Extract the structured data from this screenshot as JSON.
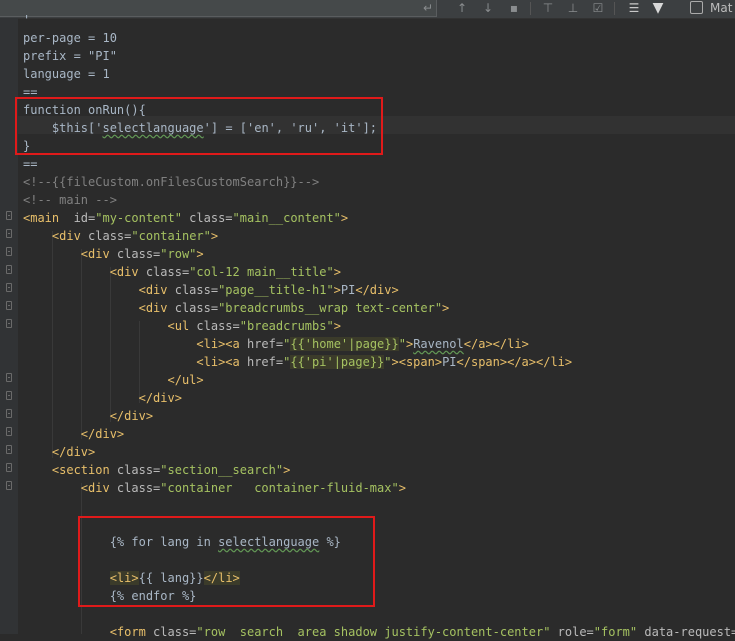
{
  "toolbar": {
    "icons": [
      "enter-icon",
      "arrow-up-icon",
      "arrow-down-icon",
      "select-all-icon",
      "add-occurrence-icon",
      "remove-occurrence-icon",
      "check-occurrence-icon",
      "multiline-icon",
      "filter-icon"
    ],
    "match_case_label": "Mat"
  },
  "code": {
    "lines": [
      {
        "segments": [
          {
            "t": "'",
            "c": "t-txt"
          }
        ]
      },
      {
        "segments": [
          {
            "t": "per-page = 10",
            "c": "t-txt"
          }
        ]
      },
      {
        "segments": [
          {
            "t": "prefix = \"PI\"",
            "c": "t-txt"
          }
        ]
      },
      {
        "segments": [
          {
            "t": "language = 1",
            "c": "t-txt"
          }
        ]
      },
      {
        "segments": [
          {
            "t": "==",
            "c": "t-txt"
          }
        ]
      },
      {
        "segments": [
          {
            "t": "function onRun(){",
            "c": "t-txt"
          }
        ]
      },
      {
        "segments": [
          {
            "t": "    $this['",
            "c": "t-txt"
          },
          {
            "t": "selectlanguage",
            "c": "t-txt t-und"
          },
          {
            "t": "'] = ['en', 'ru', 'it'];",
            "c": "t-txt"
          }
        ]
      },
      {
        "segments": [
          {
            "t": "}",
            "c": "t-txt"
          }
        ]
      },
      {
        "segments": [
          {
            "t": "==",
            "c": "t-txt"
          }
        ]
      },
      {
        "segments": [
          {
            "t": "<!--{{fileCustom.onFilesCustomSearch}}-->",
            "c": "t-cmt"
          }
        ]
      },
      {
        "segments": [
          {
            "t": "<!-- main -->",
            "c": "t-cmt"
          }
        ]
      },
      {
        "segments": [
          {
            "t": "<main",
            "c": "t-tag"
          },
          {
            "t": "  id=",
            "c": "t-attr"
          },
          {
            "t": "\"my-content\"",
            "c": "t-str"
          },
          {
            "t": " class=",
            "c": "t-attr"
          },
          {
            "t": "\"main__content\"",
            "c": "t-str"
          },
          {
            "t": ">",
            "c": "t-tag"
          }
        ]
      },
      {
        "segments": [
          {
            "t": "    ",
            "c": "t-txt"
          },
          {
            "t": "<div",
            "c": "t-tag"
          },
          {
            "t": " class=",
            "c": "t-attr"
          },
          {
            "t": "\"container\"",
            "c": "t-str"
          },
          {
            "t": ">",
            "c": "t-tag"
          }
        ]
      },
      {
        "segments": [
          {
            "t": "        ",
            "c": "t-txt"
          },
          {
            "t": "<div",
            "c": "t-tag"
          },
          {
            "t": " class=",
            "c": "t-attr"
          },
          {
            "t": "\"row\"",
            "c": "t-str"
          },
          {
            "t": ">",
            "c": "t-tag"
          }
        ]
      },
      {
        "segments": [
          {
            "t": "            ",
            "c": "t-txt"
          },
          {
            "t": "<div",
            "c": "t-tag"
          },
          {
            "t": " class=",
            "c": "t-attr"
          },
          {
            "t": "\"col-12 main__title\"",
            "c": "t-str"
          },
          {
            "t": ">",
            "c": "t-tag"
          }
        ]
      },
      {
        "segments": [
          {
            "t": "                ",
            "c": "t-txt"
          },
          {
            "t": "<div",
            "c": "t-tag"
          },
          {
            "t": " class=",
            "c": "t-attr"
          },
          {
            "t": "\"page__title-h1\"",
            "c": "t-str"
          },
          {
            "t": ">",
            "c": "t-tag"
          },
          {
            "t": "PI",
            "c": "t-txt"
          },
          {
            "t": "</div>",
            "c": "t-tag"
          }
        ]
      },
      {
        "segments": [
          {
            "t": "                ",
            "c": "t-txt"
          },
          {
            "t": "<div",
            "c": "t-tag"
          },
          {
            "t": " class=",
            "c": "t-attr"
          },
          {
            "t": "\"breadcrumbs__wrap text-center\"",
            "c": "t-str"
          },
          {
            "t": ">",
            "c": "t-tag"
          }
        ]
      },
      {
        "segments": [
          {
            "t": "                    ",
            "c": "t-txt"
          },
          {
            "t": "<ul",
            "c": "t-tag"
          },
          {
            "t": " class=",
            "c": "t-attr"
          },
          {
            "t": "\"breadcrumbs\"",
            "c": "t-str"
          },
          {
            "t": ">",
            "c": "t-tag"
          }
        ]
      },
      {
        "segments": [
          {
            "t": "                        ",
            "c": "t-txt"
          },
          {
            "t": "<li><a",
            "c": "t-tag"
          },
          {
            "t": " href=",
            "c": "t-attr"
          },
          {
            "t": "\"",
            "c": "t-str"
          },
          {
            "t": "{{'home'|page}}",
            "c": "t-twig"
          },
          {
            "t": "\"",
            "c": "t-str"
          },
          {
            "t": ">",
            "c": "t-tag"
          },
          {
            "t": "Ravenol",
            "c": "t-txt t-und"
          },
          {
            "t": "</a></li>",
            "c": "t-tag"
          }
        ]
      },
      {
        "segments": [
          {
            "t": "                        ",
            "c": "t-txt"
          },
          {
            "t": "<li><a",
            "c": "t-tag"
          },
          {
            "t": " href=",
            "c": "t-attr"
          },
          {
            "t": "\"",
            "c": "t-str"
          },
          {
            "t": "{{'pi'|page}}",
            "c": "t-twig"
          },
          {
            "t": "\"",
            "c": "t-str"
          },
          {
            "t": "><span>",
            "c": "t-tag"
          },
          {
            "t": "PI",
            "c": "t-txt"
          },
          {
            "t": "</span></a></li>",
            "c": "t-tag"
          }
        ]
      },
      {
        "segments": [
          {
            "t": "                    ",
            "c": "t-txt"
          },
          {
            "t": "</ul>",
            "c": "t-tag"
          }
        ]
      },
      {
        "segments": [
          {
            "t": "                ",
            "c": "t-txt"
          },
          {
            "t": "</div>",
            "c": "t-tag"
          }
        ]
      },
      {
        "segments": [
          {
            "t": "            ",
            "c": "t-txt"
          },
          {
            "t": "</div>",
            "c": "t-tag"
          }
        ]
      },
      {
        "segments": [
          {
            "t": "        ",
            "c": "t-txt"
          },
          {
            "t": "</div>",
            "c": "t-tag"
          }
        ]
      },
      {
        "segments": [
          {
            "t": "    ",
            "c": "t-txt"
          },
          {
            "t": "</div>",
            "c": "t-tag"
          }
        ]
      },
      {
        "segments": [
          {
            "t": "    ",
            "c": "t-txt"
          },
          {
            "t": "<section",
            "c": "t-tag"
          },
          {
            "t": " class=",
            "c": "t-attr"
          },
          {
            "t": "\"section__search\"",
            "c": "t-str"
          },
          {
            "t": ">",
            "c": "t-tag"
          }
        ]
      },
      {
        "segments": [
          {
            "t": "        ",
            "c": "t-txt"
          },
          {
            "t": "<div",
            "c": "t-tag"
          },
          {
            "t": " class=",
            "c": "t-attr"
          },
          {
            "t": "\"container   container-fluid-max\"",
            "c": "t-str"
          },
          {
            "t": ">",
            "c": "t-tag"
          }
        ]
      },
      {
        "segments": []
      },
      {
        "segments": []
      },
      {
        "segments": [
          {
            "t": "            {% for lang in ",
            "c": "t-txt"
          },
          {
            "t": "selectlanguage",
            "c": "t-txt t-und"
          },
          {
            "t": " %}",
            "c": "t-txt"
          }
        ]
      },
      {
        "segments": []
      },
      {
        "segments": [
          {
            "t": "            ",
            "c": "t-txt"
          },
          {
            "t": "<li>",
            "c": "t-tag t-sel"
          },
          {
            "t": "{{ lang}}",
            "c": "t-txt"
          },
          {
            "t": "</li>",
            "c": "t-tag t-sel"
          }
        ]
      },
      {
        "segments": [
          {
            "t": "            {% endfor %}",
            "c": "t-txt"
          }
        ]
      },
      {
        "segments": []
      },
      {
        "segments": [
          {
            "t": "            ",
            "c": "t-txt"
          },
          {
            "t": "<form",
            "c": "t-tag"
          },
          {
            "t": " class=",
            "c": "t-attr"
          },
          {
            "t": "\"row  search  area shadow justify-content-center\"",
            "c": "t-str"
          },
          {
            "t": " role=",
            "c": "t-attr"
          },
          {
            "t": "\"form\"",
            "c": "t-str"
          },
          {
            "t": " data-request=",
            "c": "t-attr"
          },
          {
            "t": "\"on",
            "c": "t-str"
          }
        ]
      }
    ]
  }
}
